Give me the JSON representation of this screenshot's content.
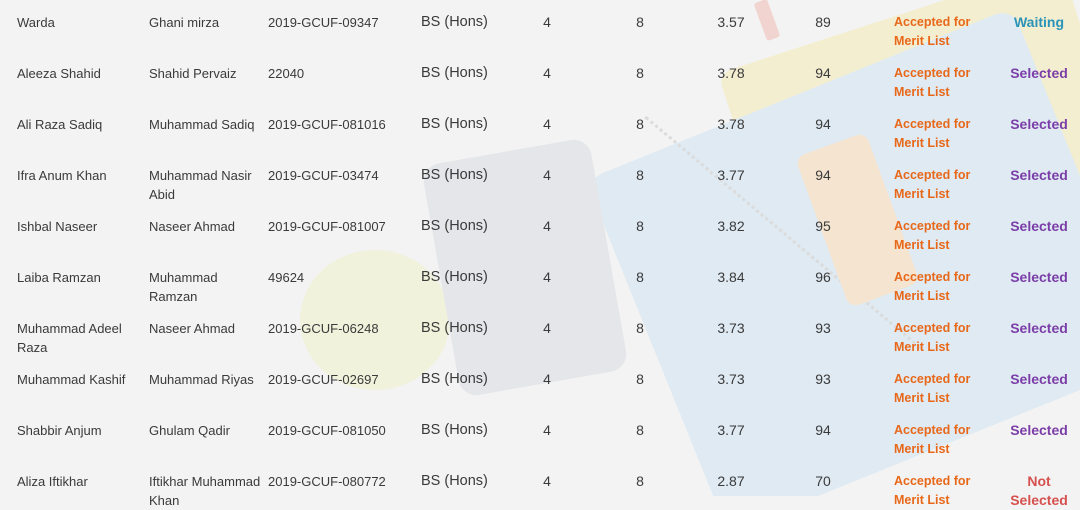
{
  "rows": [
    {
      "name": "Warda",
      "father": "Ghani mirza",
      "roll": "2019-GCUF-09347",
      "program": "BS (Hons)",
      "years": "4",
      "semesters": "8",
      "cgpa": "3.57",
      "score": "89",
      "status": "Accepted for Merit List",
      "result": "Waiting",
      "result_type": "waiting"
    },
    {
      "name": "Aleeza Shahid",
      "father": "Shahid Pervaiz",
      "roll": "22040",
      "program": "BS (Hons)",
      "years": "4",
      "semesters": "8",
      "cgpa": "3.78",
      "score": "94",
      "status": "Accepted for Merit List",
      "result": "Selected",
      "result_type": "selected"
    },
    {
      "name": "Ali Raza Sadiq",
      "father": "Muhammad Sadiq",
      "roll": "2019-GCUF-081016",
      "program": "BS (Hons)",
      "years": "4",
      "semesters": "8",
      "cgpa": "3.78",
      "score": "94",
      "status": "Accepted for Merit List",
      "result": "Selected",
      "result_type": "selected"
    },
    {
      "name": "Ifra Anum Khan",
      "father": "Muhammad Nasir Abid",
      "roll": "2019-GCUF-03474",
      "program": "BS (Hons)",
      "years": "4",
      "semesters": "8",
      "cgpa": "3.77",
      "score": "94",
      "status": "Accepted for Merit List",
      "result": "Selected",
      "result_type": "selected"
    },
    {
      "name": "Ishbal Naseer",
      "father": "Naseer Ahmad",
      "roll": "2019-GCUF-081007",
      "program": "BS (Hons)",
      "years": "4",
      "semesters": "8",
      "cgpa": "3.82",
      "score": "95",
      "status": "Accepted for Merit List",
      "result": "Selected",
      "result_type": "selected"
    },
    {
      "name": "Laiba Ramzan",
      "father": "Muhammad Ramzan",
      "roll": "49624",
      "program": "BS (Hons)",
      "years": "4",
      "semesters": "8",
      "cgpa": "3.84",
      "score": "96",
      "status": "Accepted for Merit List",
      "result": "Selected",
      "result_type": "selected"
    },
    {
      "name": "Muhammad Adeel Raza",
      "father": "Naseer Ahmad",
      "roll": "2019-GCUF-06248",
      "program": "BS (Hons)",
      "years": "4",
      "semesters": "8",
      "cgpa": "3.73",
      "score": "93",
      "status": "Accepted for Merit List",
      "result": "Selected",
      "result_type": "selected"
    },
    {
      "name": "Muhammad Kashif",
      "father": "Muhammad Riyas",
      "roll": "2019-GCUF-02697",
      "program": "BS (Hons)",
      "years": "4",
      "semesters": "8",
      "cgpa": "3.73",
      "score": "93",
      "status": "Accepted for Merit List",
      "result": "Selected",
      "result_type": "selected"
    },
    {
      "name": "Shabbir Anjum",
      "father": "Ghulam Qadir",
      "roll": "2019-GCUF-081050",
      "program": "BS (Hons)",
      "years": "4",
      "semesters": "8",
      "cgpa": "3.77",
      "score": "94",
      "status": "Accepted for Merit List",
      "result": "Selected",
      "result_type": "selected"
    },
    {
      "name": "Aliza Iftikhar",
      "father": "Iftikhar Muhammad Khan",
      "roll": "2019-GCUF-080772",
      "program": "BS (Hons)",
      "years": "4",
      "semesters": "8",
      "cgpa": "2.87",
      "score": "70",
      "status": "Accepted for Merit List",
      "result": "Not Selected",
      "result_type": "not"
    }
  ]
}
